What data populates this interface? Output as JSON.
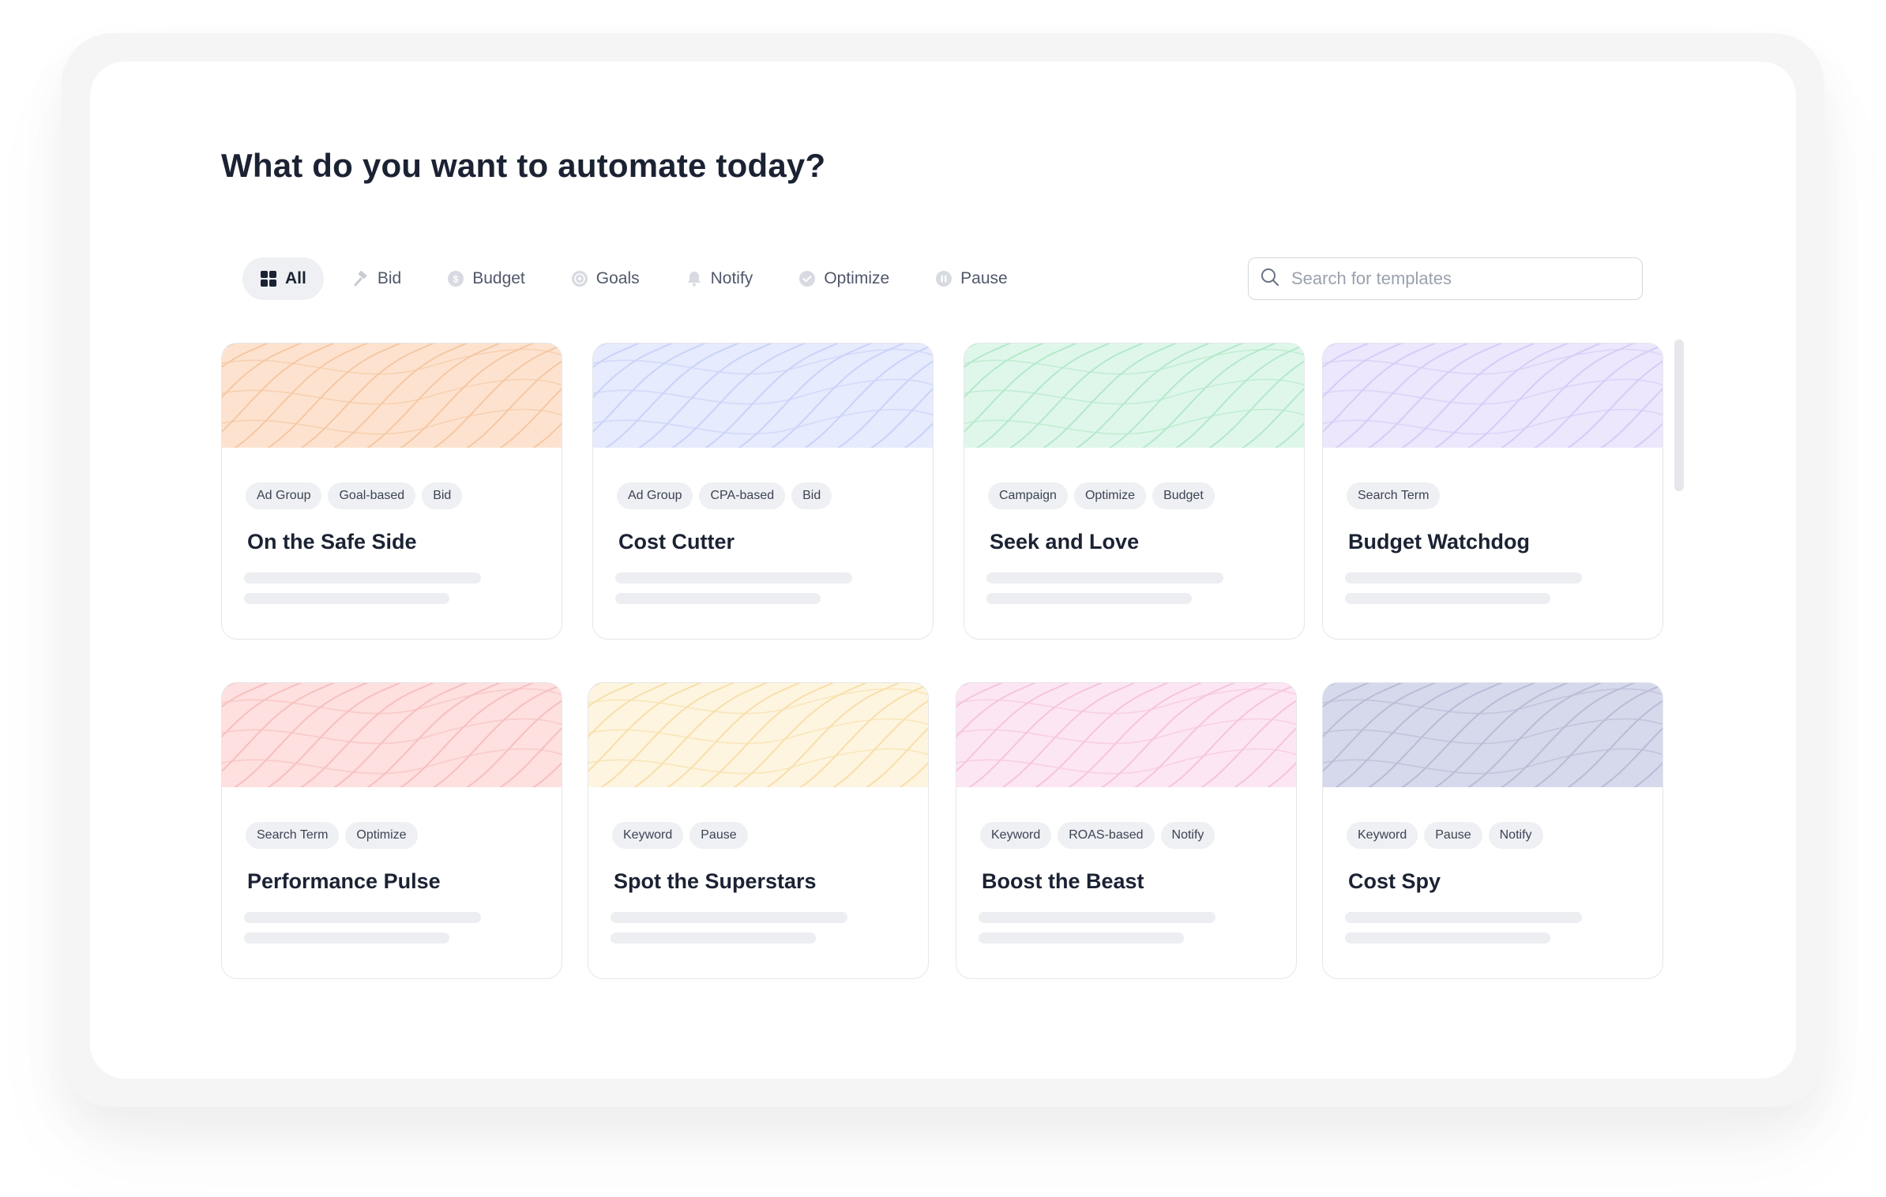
{
  "page": {
    "title": "What do you want to automate today?"
  },
  "filters": [
    {
      "label": "All",
      "icon": "grid-icon",
      "active": true
    },
    {
      "label": "Bid",
      "icon": "gavel-icon",
      "active": false
    },
    {
      "label": "Budget",
      "icon": "dollar-coin-icon",
      "active": false
    },
    {
      "label": "Goals",
      "icon": "target-icon",
      "active": false
    },
    {
      "label": "Notify",
      "icon": "bell-icon",
      "active": false
    },
    {
      "label": "Optimize",
      "icon": "check-circle-icon",
      "active": false
    },
    {
      "label": "Pause",
      "icon": "pause-circle-icon",
      "active": false
    }
  ],
  "search": {
    "placeholder": "Search for templates",
    "value": ""
  },
  "colors": {
    "orange": {
      "bg": "#fde3cf",
      "line": "#f5c7a4"
    },
    "blue": {
      "bg": "#e6ebfd",
      "line": "#c9d3f8"
    },
    "green": {
      "bg": "#dff7ea",
      "line": "#b4e8cb"
    },
    "purple": {
      "bg": "#ece7fc",
      "line": "#d6ccf6"
    },
    "red": {
      "bg": "#fde0df",
      "line": "#f6c0bf"
    },
    "yellow": {
      "bg": "#fef5e0",
      "line": "#f7dfaa"
    },
    "pink": {
      "bg": "#fde6f3",
      "line": "#f5c4df"
    },
    "slate": {
      "bg": "#d6d9ec",
      "line": "#b8bcd6"
    }
  },
  "cards": [
    {
      "title": "On the Safe Side",
      "tags": [
        "Ad Group",
        "Goal-based",
        "Bid"
      ],
      "color": "orange"
    },
    {
      "title": "Cost Cutter",
      "tags": [
        "Ad Group",
        "CPA-based",
        "Bid"
      ],
      "color": "blue"
    },
    {
      "title": "Seek and Love",
      "tags": [
        "Campaign",
        "Optimize",
        "Budget"
      ],
      "color": "green"
    },
    {
      "title": "Budget Watchdog",
      "tags": [
        "Search Term"
      ],
      "color": "purple"
    },
    {
      "title": "Performance Pulse",
      "tags": [
        "Search Term",
        "Optimize"
      ],
      "color": "red"
    },
    {
      "title": "Spot the Superstars",
      "tags": [
        "Keyword",
        "Pause"
      ],
      "color": "yellow"
    },
    {
      "title": "Boost the Beast",
      "tags": [
        "Keyword",
        "ROAS-based",
        "Notify"
      ],
      "color": "pink"
    },
    {
      "title": "Cost Spy",
      "tags": [
        "Keyword",
        "Pause",
        "Notify"
      ],
      "color": "slate"
    }
  ]
}
